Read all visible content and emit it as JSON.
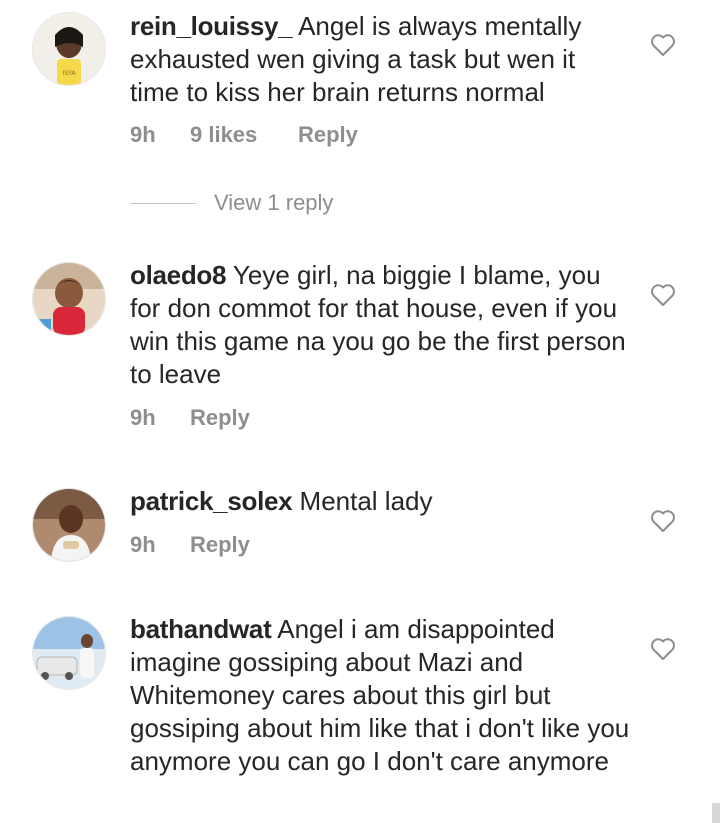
{
  "comments": [
    {
      "username": "rein_louissy_",
      "text": "Angel is always mentally exhausted wen giving a task but wen it time to kiss her brain returns normal",
      "time": "9h",
      "likes": "9 likes",
      "reply": "Reply",
      "view_replies": "View 1 reply"
    },
    {
      "username": "olaedo8",
      "text": "Yeye girl, na biggie I blame, you for don commot for that house, even if you win this game na you go be the first person to leave",
      "time": "9h",
      "reply": "Reply"
    },
    {
      "username": "patrick_solex",
      "text": "Mental lady",
      "time": "9h",
      "reply": "Reply"
    },
    {
      "username": "bathandwat",
      "text": "Angel i am disappointed imagine gossiping about Mazi and Whitemoney cares about this girl but gossiping about him like that i don't like you anymore you can go I don't care anymore"
    }
  ],
  "icons": {
    "like": "heart-outline-icon",
    "avatar": "avatar"
  },
  "colors": {
    "text": "#262626",
    "muted": "#8e8e8e",
    "background": "#ffffff"
  }
}
